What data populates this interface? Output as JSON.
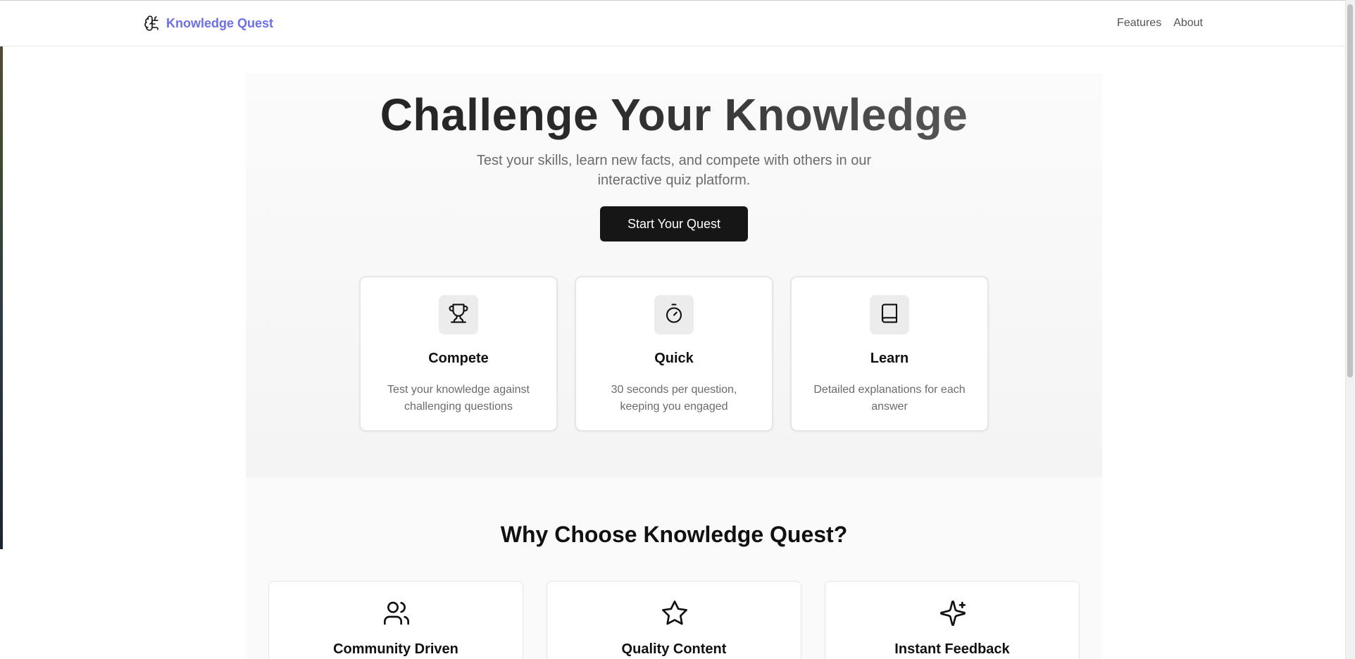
{
  "nav": {
    "brand": "Knowledge Quest",
    "brand_icon": "brain-icon",
    "links": [
      "Features",
      "About"
    ]
  },
  "hero": {
    "title": "Challenge Your Knowledge",
    "subtitle": "Test your skills, learn new facts, and compete with others in our interactive quiz platform.",
    "cta_label": "Start Your Quest"
  },
  "features": [
    {
      "icon": "trophy-icon",
      "title": "Compete",
      "description": "Test your knowledge against challenging questions"
    },
    {
      "icon": "timer-icon",
      "title": "Quick",
      "description": "30 seconds per question, keeping you engaged"
    },
    {
      "icon": "book-icon",
      "title": "Learn",
      "description": "Detailed explanations for each answer"
    }
  ],
  "why": {
    "title": "Why Choose Knowledge Quest?",
    "cards": [
      {
        "icon": "users-icon",
        "title": "Community Driven"
      },
      {
        "icon": "star-icon",
        "title": "Quality Content"
      },
      {
        "icon": "sparkles-icon",
        "title": "Instant Feedback"
      }
    ]
  },
  "colors": {
    "brand": "#6b6ef0",
    "cta_bg": "#161616",
    "muted_text": "#6b6b6b"
  }
}
